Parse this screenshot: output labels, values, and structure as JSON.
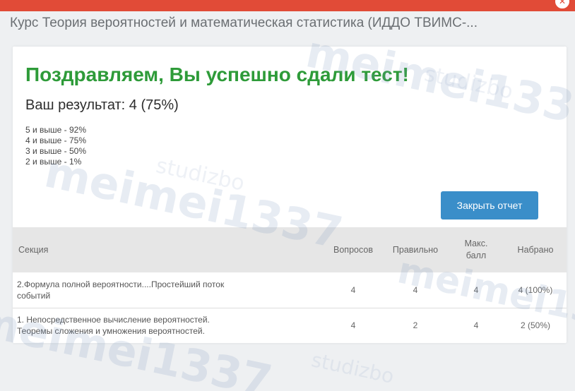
{
  "header": {
    "course_title": "Курс Теория вероятностей и математическая статистика (ИДДО ТВИМС-..."
  },
  "report": {
    "congrats": "Поздравляем, Вы успешно сдали тест!",
    "result": "Ваш результат: 4 (75%)",
    "grades": [
      "5 и выше - 92%",
      "4 и выше - 75%",
      "3 и выше - 50%",
      "2 и выше - 1%"
    ],
    "close_label": "Закрыть отчет"
  },
  "table": {
    "headers": {
      "section": "Секция",
      "questions": "Вопросов",
      "correct": "Правильно",
      "max_line1": "Макс.",
      "max_line2": "балл",
      "scored": "Набрано"
    },
    "rows": [
      {
        "section_line1": "2.Формула полной вероятности....Простейший поток",
        "section_line2": "событий",
        "questions": "4",
        "correct": "4",
        "max": "4",
        "scored": "4 (100%)"
      },
      {
        "section_line1": "1. Непосредственное вычисление вероятностей.",
        "section_line2": "Теоремы сложения и умножения вероятностей.",
        "questions": "4",
        "correct": "2",
        "max": "4",
        "scored": "2 (50%)"
      }
    ]
  },
  "watermark": {
    "text": "meimei1337",
    "brand": "studizbo"
  },
  "colors": {
    "top_bar": "#e14b37",
    "success_green": "#2e9b39",
    "button_blue": "#3a8ec9",
    "table_header": "#e6e6e6"
  }
}
